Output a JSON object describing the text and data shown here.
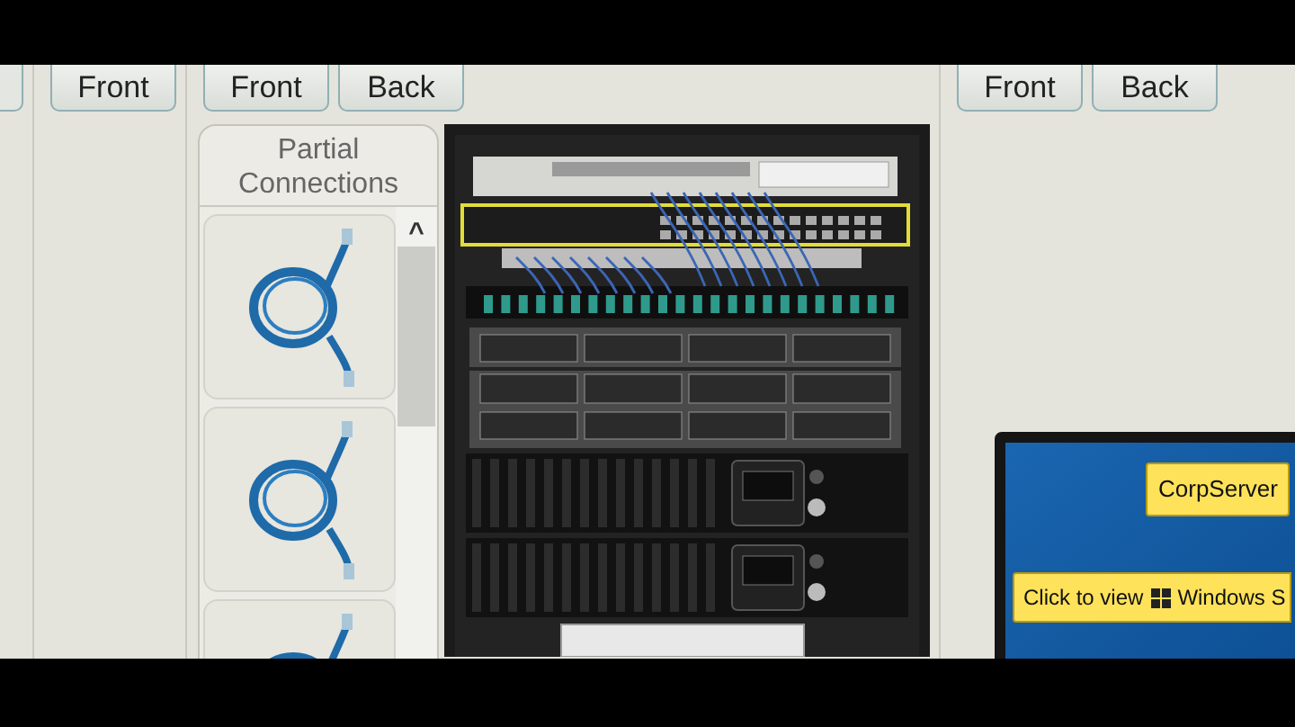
{
  "views": [
    {
      "kind": "cut_tab"
    },
    {
      "buttons": [
        "Front"
      ]
    },
    {
      "buttons": [
        "Front",
        "Back"
      ]
    },
    {
      "buttons": [
        "Front",
        "Back"
      ]
    }
  ],
  "partial_connections": {
    "title": "Partial Connections",
    "scroll_up": "^",
    "items": [
      {
        "kind": "cable"
      },
      {
        "kind": "cable"
      },
      {
        "kind": "cable"
      }
    ]
  },
  "desktop": {
    "server_label": "CorpServer",
    "view_prompt": {
      "before": "Click to view",
      "after": "Windows S"
    }
  }
}
